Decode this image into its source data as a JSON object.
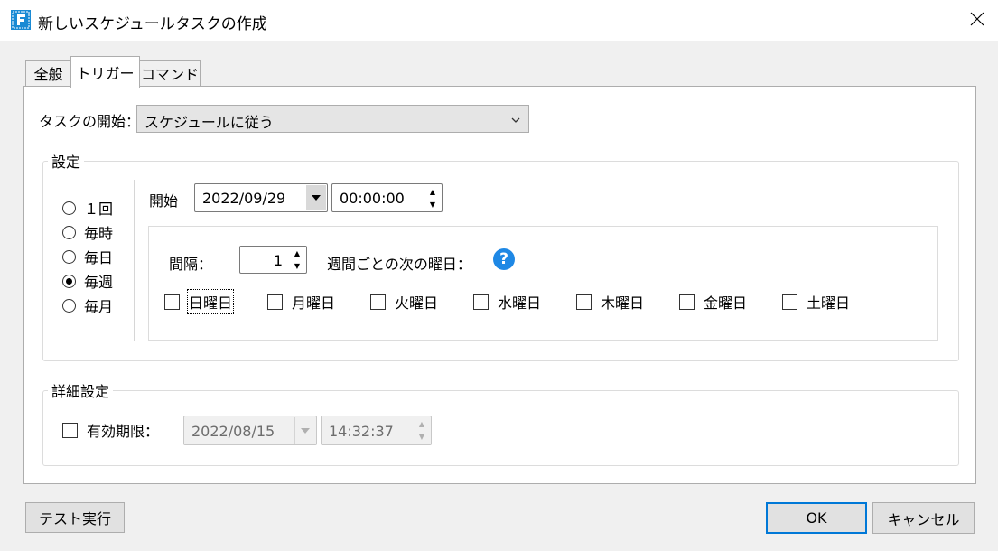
{
  "window": {
    "title": "新しいスケジュールタスクの作成"
  },
  "tabs": [
    {
      "label": "全般"
    },
    {
      "label": "トリガー"
    },
    {
      "label": "コマンド"
    }
  ],
  "trigger": {
    "start_label": "タスクの開始：",
    "start_value": "スケジュールに従う",
    "settings_group": "設定",
    "frequency": [
      {
        "label": "１回",
        "selected": false
      },
      {
        "label": "毎時",
        "selected": false
      },
      {
        "label": "毎日",
        "selected": false
      },
      {
        "label": "毎週",
        "selected": true
      },
      {
        "label": "毎月",
        "selected": false
      }
    ],
    "start_time_label": "開始",
    "start_date": "2022/09/29",
    "start_clock": "00:00:00",
    "interval_label": "間隔：",
    "interval_value": "1",
    "weekday_label": "週間ごとの次の曜日：",
    "days": [
      {
        "label": "日曜日",
        "checked": false
      },
      {
        "label": "月曜日",
        "checked": false
      },
      {
        "label": "火曜日",
        "checked": false
      },
      {
        "label": "水曜日",
        "checked": false
      },
      {
        "label": "木曜日",
        "checked": false
      },
      {
        "label": "金曜日",
        "checked": false
      },
      {
        "label": "土曜日",
        "checked": false
      }
    ],
    "advanced_group": "詳細設定",
    "expiry_label": "有効期限：",
    "expiry_checked": false,
    "expiry_date": "2022/08/15",
    "expiry_time": "14:32:37"
  },
  "footer": {
    "test_button": "テスト実行",
    "ok_button": "OK",
    "cancel_button": "キャンセル"
  },
  "colors": {
    "accent": "#0078d7",
    "help_icon": "#1e88e5"
  },
  "icons": {
    "app": "app-logo-icon",
    "close": "close-icon",
    "help": "help-icon"
  }
}
